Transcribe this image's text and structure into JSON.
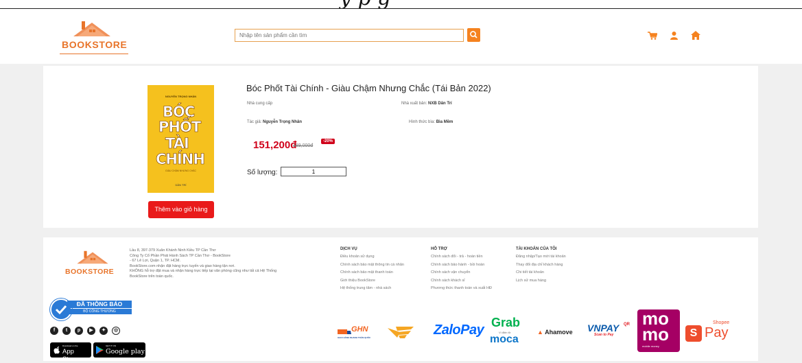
{
  "top_strip": {
    "text": "y             p                    g"
  },
  "brand": {
    "name": "BOOKSTORE"
  },
  "search": {
    "placeholder": "Nhập tên sản phẩm cần tìm"
  },
  "product": {
    "title": "Bóc Phốt Tài Chính - Giàu Chậm Nhưng Chắc (Tái Bản 2022)",
    "supplier_label": "Nhà cung cấp",
    "publisher_label": "Nhà xuất bản:",
    "publisher": "NXB Dân Trí",
    "author_label": "Tác giả:",
    "author": "Nguyễn Trọng Nhân",
    "format_label": "Hình thức bìa:",
    "format": "Bìa Mềm",
    "price": "151,200đ",
    "old_price": "189,000đ",
    "discount": "-20%",
    "qty_label": "Số lượng:",
    "qty_value": "1",
    "add_to_cart": "Thêm vào giỏ hàng",
    "cover": {
      "author": "NGUYỄN TRỌNG NHÂN",
      "line1": "BÓC",
      "line2": "PHỐT",
      "line3": "TÀI",
      "line4": "CHÍNH",
      "subtitle": "GIÀU CHẬM NHƯNG CHẮC",
      "publisher": "DÂN TRÍ"
    }
  },
  "footer": {
    "address_lines": [
      "Lầu 8, 397-379 Xuân Khánh Ninh Kiều TP Cần Thơ",
      "Công Ty Cổ Phần Phát Hành Sách TP Cần Thơ - BookStore",
      "- 67 Lê Lợi, Quận 1, TP. HCM.",
      "BookStore.com nhận đặt hàng trực tuyến và giao hàng tận nơi.",
      "KHÔNG hỗ trợ đặt mua và nhận hàng trực tiếp tại văn phòng cũng như tất cả Hệ Thống",
      "BookStore trên toàn quốc."
    ],
    "badge_line1": "ĐÃ THÔNG BÁO",
    "badge_line2": "BỘ CÔNG THƯƠNG",
    "app_store_small": "Download on the",
    "app_store": "App Store",
    "google_play_small": "GET IT ON",
    "google_play": "Google play",
    "columns": [
      {
        "heading": "DỊCH VỤ",
        "items": [
          "Điều khoản sử dụng",
          "Chính sách bảo mật thông tin cá nhân",
          "Chính sách bảo mật thanh toán",
          "Giới thiệu BookStore",
          "Hệ thống trung tâm - nhà sách"
        ]
      },
      {
        "heading": "HỖ TRỢ",
        "items": [
          "Chính sách đổi - trả - hoàn tiền",
          "Chính sách bảo hành - bồi hoàn",
          "Chính sách vận chuyển",
          "Chính sách khách sỉ",
          "Phương thức thanh toán và xuất HĐ"
        ]
      },
      {
        "heading": "TÀI KHOẢN CỦA TÔI",
        "items": [
          "Đăng nhập/Tạo mới tài khoản",
          "Thay đổi địa chỉ khách hàng",
          "Chi tiết tài khoản",
          "Lịch sử mua hàng"
        ]
      }
    ],
    "partners": {
      "ghn": "GHN",
      "ghn_sub": "GIAO HÀNG NHANH TOÀN QUỐC",
      "zalopay": "ZaloPay",
      "grab": "Grab",
      "grab_sub": "Ví điện tử",
      "moca": "moca",
      "ahamove": "Ahamove",
      "vnpay": "VNPAY",
      "vnpay_sup": "QR",
      "vnpay_sub": "Scan to Pay",
      "momo1": "mo",
      "momo2": "mo",
      "momo_sub": "mobile money",
      "shopee_top": "Shopee",
      "shopee": "Pay",
      "shopee_s": "S"
    }
  },
  "colors": {
    "brand": "#e8742a",
    "accent": "#f5821f",
    "price": "#d0021b",
    "button": "#e91a1a"
  }
}
